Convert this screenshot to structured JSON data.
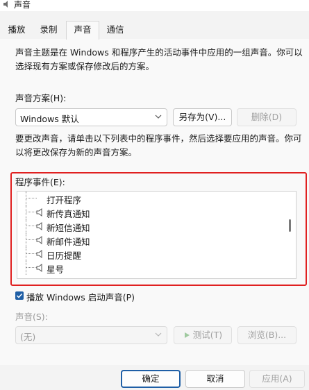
{
  "window": {
    "title": "声音"
  },
  "tabs": [
    {
      "label": "播放"
    },
    {
      "label": "录制"
    },
    {
      "label": "声音"
    },
    {
      "label": "通信"
    }
  ],
  "intro": {
    "line1": "声音主题是在 Windows 和程序产生的活动事件中应用的一组声音。你可以",
    "line2": "选择现有方案或保存修改后的方案。"
  },
  "scheme": {
    "label": "声音方案(H):",
    "selected": "Windows 默认",
    "save_as": "另存为(V)...",
    "delete": "删除(D)"
  },
  "instructions": {
    "line1": "要更改声音，请单击以下列表中的程序事件，然后选择要应用的声音。你可",
    "line2": "以将更改保存为新的声音方案。"
  },
  "events": {
    "label": "程序事件(E):",
    "items": [
      {
        "label": "打开程序",
        "has_sound": false
      },
      {
        "label": "新传真通知",
        "has_sound": true
      },
      {
        "label": "新短信通知",
        "has_sound": true
      },
      {
        "label": "新邮件通知",
        "has_sound": true
      },
      {
        "label": "日历提醒",
        "has_sound": true
      },
      {
        "label": "星号",
        "has_sound": true
      }
    ]
  },
  "startup": {
    "checked": true,
    "label": "播放 Windows 启动声音(P)"
  },
  "sound": {
    "label": "声音(S):",
    "selected": "(无)",
    "test": "测试(T)",
    "browse": "浏览(B)..."
  },
  "footer": {
    "ok": "确定",
    "cancel": "取消",
    "apply": "应用(A)"
  },
  "colors": {
    "accent": "#1f5fa6",
    "highlight_border": "#e02020",
    "disabled_text": "#a0a0a0"
  }
}
